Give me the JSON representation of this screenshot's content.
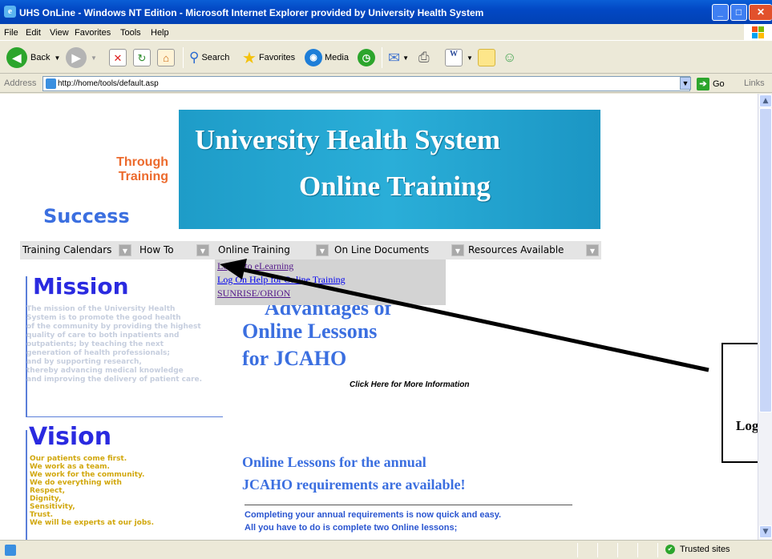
{
  "window": {
    "title": "UHS OnLine - Windows NT Edition - Microsoft Internet Explorer provided by University Health System",
    "ie_icon": "ie-icon"
  },
  "menu": [
    "File",
    "Edit",
    "View",
    "Favorites",
    "Tools",
    "Help"
  ],
  "toolbar": {
    "back": "Back",
    "search": "Search",
    "favorites": "Favorites",
    "media": "Media"
  },
  "address": {
    "label": "Address",
    "url": "http://home/tools/default.asp",
    "go": "Go",
    "links": "Links"
  },
  "banner": {
    "line1": "University Health System",
    "line2": "Online Training"
  },
  "slogan": {
    "through": "Through",
    "training": "Training",
    "success": "Success"
  },
  "nav": [
    "Training Calendars",
    "How To",
    "Online Training",
    "On Line Documents",
    "Resources Available"
  ],
  "dropdown": [
    "Logon to eLearning",
    "Log On Help for Online Training",
    "SUNRISE/ORION"
  ],
  "mission": {
    "title": "Mission",
    "text": "The mission of the University Health\nSystem is to promote the good health\nof the community by providing the highest\nquality of care to both inpatients and\noutpatients; by teaching the next\ngeneration of health professionals;\nand by supporting research,\nthereby advancing medical knowledge\nand improving the delivery of patient care."
  },
  "vision": {
    "title": "Vision",
    "text": "Our patients come first.\nWe work as a team.\nWe work for the community.\nWe do everything with\n    Respect,\n    Dignity,\n    Sensitivity,\n    Trust.\nWe will be experts at our jobs."
  },
  "advantages": {
    "line1": "Advantages of",
    "line2": "Online Lessons",
    "line3": "for JCAHO",
    "click": "Click Here for More Information"
  },
  "annual": {
    "line1": "Online Lessons for the annual",
    "line2": "JCAHO requirements are available!",
    "completing": "Completing your annual requirements is now quick and easy.\nAll you have to do is complete two Online lessons;"
  },
  "callout": {
    "text": "Log"
  },
  "status": {
    "zone": "Trusted sites"
  },
  "colors": {
    "banner": "#2aaed8",
    "heading_blue": "#3b6fe0",
    "mission_blue": "#2a2ae0",
    "orange": "#ec6a2c",
    "gold": "#d1a70c"
  }
}
